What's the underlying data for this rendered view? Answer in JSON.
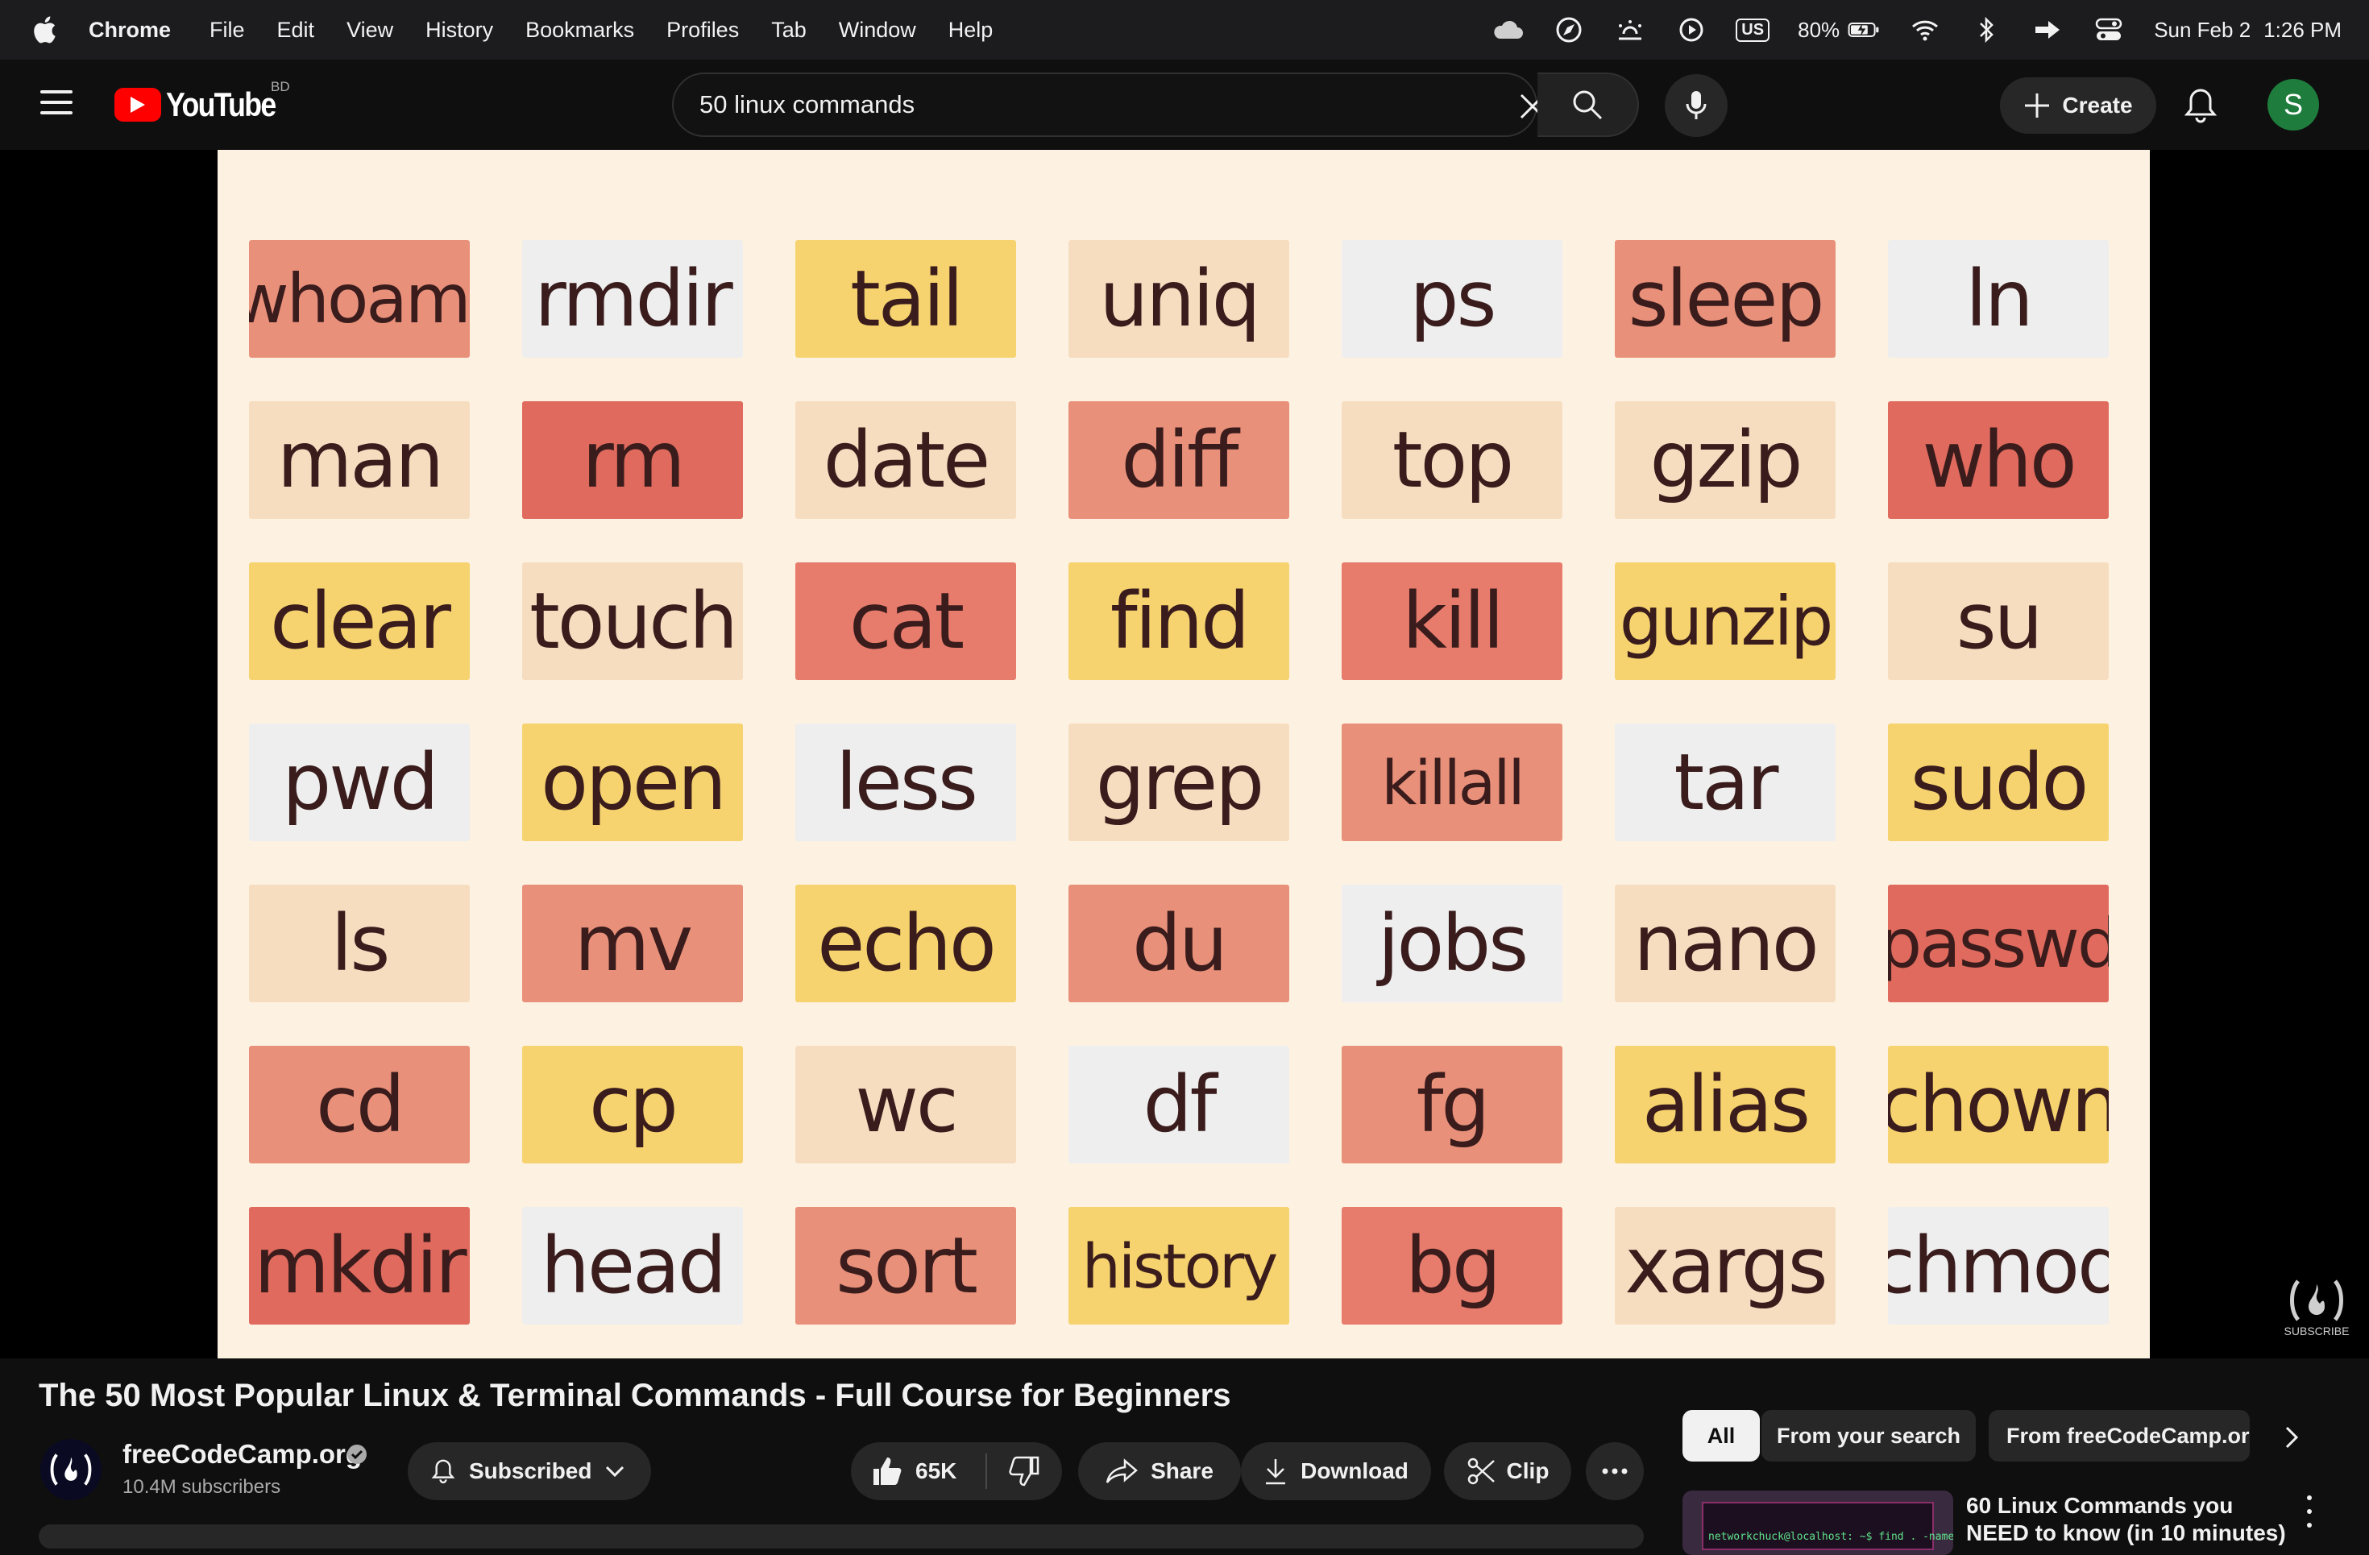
{
  "menubar": {
    "app_name": "Chrome",
    "items": [
      "File",
      "Edit",
      "View",
      "History",
      "Bookmarks",
      "Profiles",
      "Tab",
      "Window",
      "Help"
    ],
    "keyboard_layout": "US",
    "battery": "80%",
    "date": "Sun Feb 2",
    "time": "1:26 PM"
  },
  "header": {
    "logo_text": "YouTube",
    "country_code": "BD",
    "search_value": "50 linux commands",
    "create_label": "Create",
    "avatar_letter": "S",
    "avatar_color": "#1e7c3c"
  },
  "video": {
    "tiles": [
      [
        "whoami",
        "rmdir",
        "tail",
        "uniq",
        "ps",
        "sleep",
        "ln"
      ],
      [
        "man",
        "rm",
        "date",
        "diff",
        "top",
        "gzip",
        "who"
      ],
      [
        "clear",
        "touch",
        "cat",
        "find",
        "kill",
        "gunzip",
        "su"
      ],
      [
        "pwd",
        "open",
        "less",
        "grep",
        "killall",
        "tar",
        "sudo"
      ],
      [
        "ls",
        "mv",
        "echo",
        "du",
        "jobs",
        "nano",
        "passwd"
      ],
      [
        "cd",
        "cp",
        "wc",
        "df",
        "fg",
        "alias",
        "chown"
      ],
      [
        "mkdir",
        "head",
        "sort",
        "history",
        "bg",
        "xargs",
        "chmod"
      ]
    ],
    "tile_colors": [
      [
        "c1",
        "c2",
        "c3",
        "c4",
        "c2",
        "c1",
        "c2"
      ],
      [
        "c4",
        "c5",
        "c4",
        "c1",
        "c4",
        "c4",
        "c5"
      ],
      [
        "c3",
        "c4",
        "c6",
        "c3",
        "c6",
        "c3",
        "c4"
      ],
      [
        "c2",
        "c3",
        "c2",
        "c4",
        "c1",
        "c2",
        "c3"
      ],
      [
        "c4",
        "c1",
        "c3",
        "c1",
        "c2",
        "c4",
        "c5"
      ],
      [
        "c1",
        "c3",
        "c4",
        "c2",
        "c1",
        "c3",
        "c3"
      ],
      [
        "c5",
        "c2",
        "c1",
        "c3",
        "c6",
        "c4",
        "c2"
      ]
    ],
    "palette": {
      "c1": "#e9907a",
      "c2": "#eeeeee",
      "c3": "#f6d36f",
      "c4": "#f7ddc0",
      "c5": "#df6a5d",
      "c6": "#e87c6c"
    },
    "watermark_text": "SUBSCRIBE"
  },
  "info": {
    "title": "The 50 Most Popular Linux & Terminal Commands - Full Course for Beginners",
    "channel": "freeCodeCamp.org",
    "subscribers": "10.4M subscribers",
    "subscribed_label": "Subscribed",
    "likes": "65K",
    "share_label": "Share",
    "download_label": "Download",
    "clip_label": "Clip"
  },
  "sidebar": {
    "chips": [
      "All",
      "From your search",
      "From freeCodeCamp.org"
    ],
    "recommendation": {
      "title": "60 Linux Commands you NEED to know (in 10 minutes)",
      "thumb_text": "networkchuck@localhost: ~$ find . -name"
    }
  }
}
